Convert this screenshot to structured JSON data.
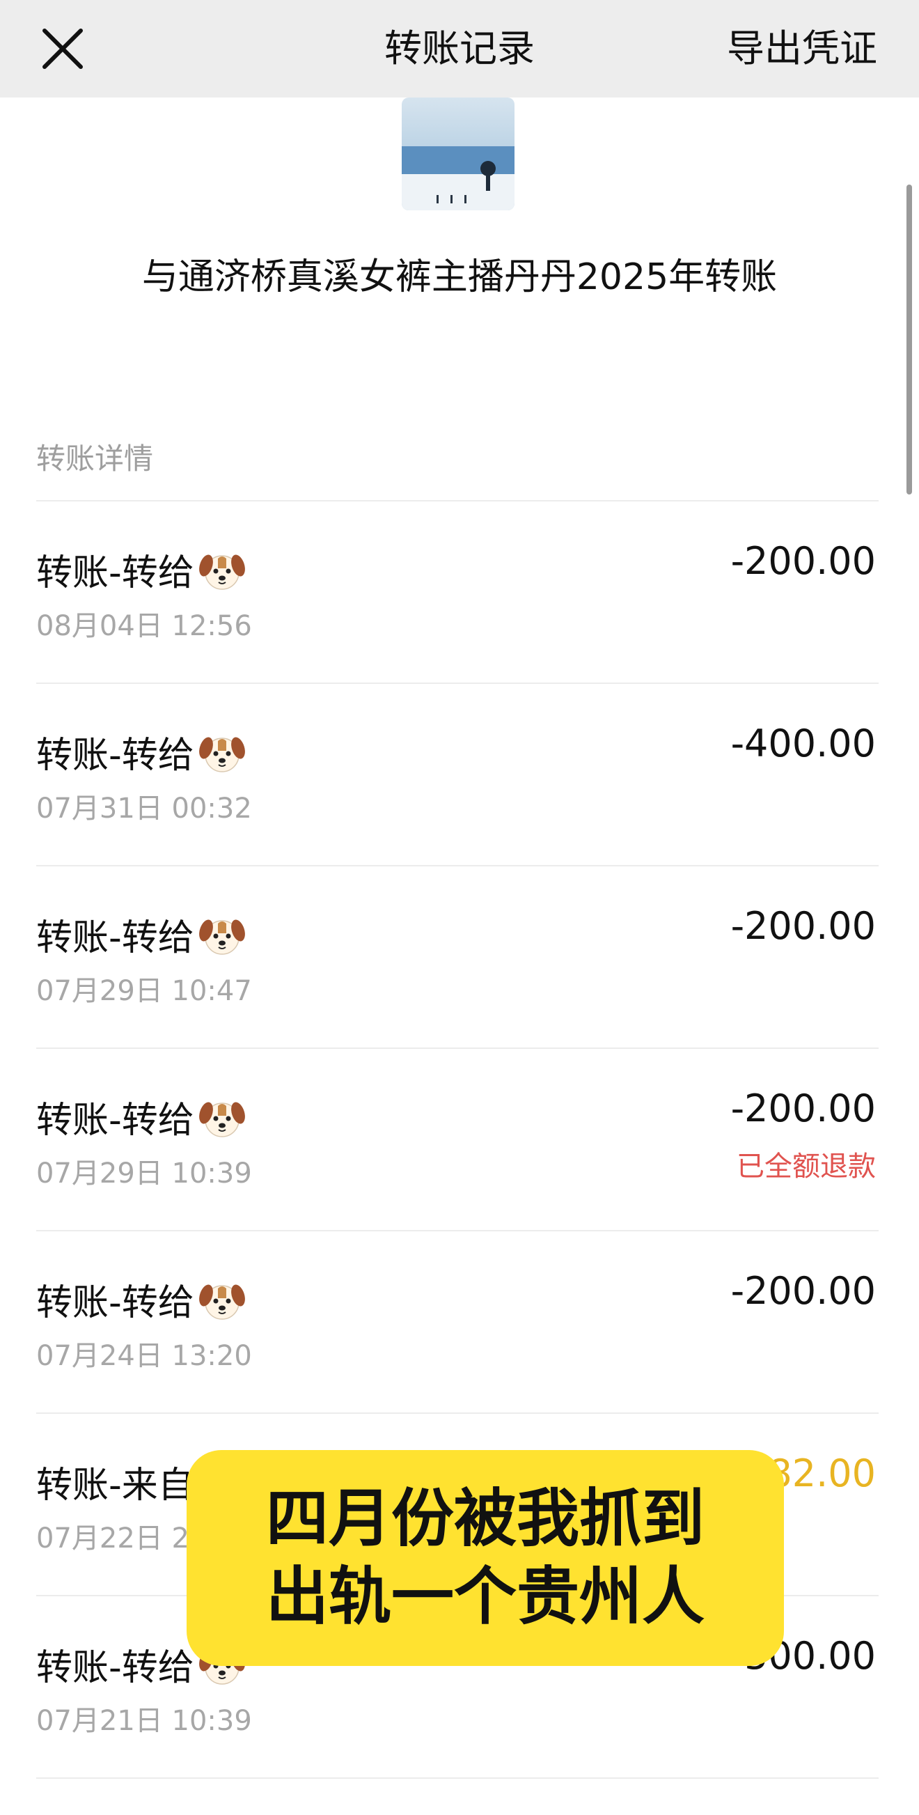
{
  "header": {
    "title": "转账记录",
    "export_label": "导出凭证",
    "close_icon": "close-icon"
  },
  "contact": {
    "title": "与通济桥真溪女裤主播丹丹2025年转账",
    "avatar": "profile-photo-icon"
  },
  "section": {
    "label": "转账详情"
  },
  "colors": {
    "income": "#e8b422",
    "refund": "#e0534f",
    "caption_bg": "#ffe230"
  },
  "records": [
    {
      "title": "转账-转给",
      "icon": "dog-face-icon",
      "time": "08月04日 12:56",
      "amount": "-200.00",
      "status": ""
    },
    {
      "title": "转账-转给",
      "icon": "dog-face-icon",
      "time": "07月31日 00:32",
      "amount": "-400.00",
      "status": ""
    },
    {
      "title": "转账-转给",
      "icon": "dog-face-icon",
      "time": "07月29日 10:47",
      "amount": "-200.00",
      "status": ""
    },
    {
      "title": "转账-转给",
      "icon": "dog-face-icon",
      "time": "07月29日 10:39",
      "amount": "-200.00",
      "status": "已全额退款"
    },
    {
      "title": "转账-转给",
      "icon": "dog-face-icon",
      "time": "07月24日 13:20",
      "amount": "-200.00",
      "status": ""
    },
    {
      "title": "转账-来自",
      "icon": "dog-face-icon",
      "time": "07月22日 2",
      "amount": "82.00",
      "status": ""
    },
    {
      "title": "转账-转给",
      "icon": "dog-face-icon",
      "time": "07月21日 10:39",
      "amount": "500.00",
      "status": ""
    }
  ],
  "caption": {
    "line1": "四月份被我抓到",
    "line2": "出轨一个贵州人"
  }
}
